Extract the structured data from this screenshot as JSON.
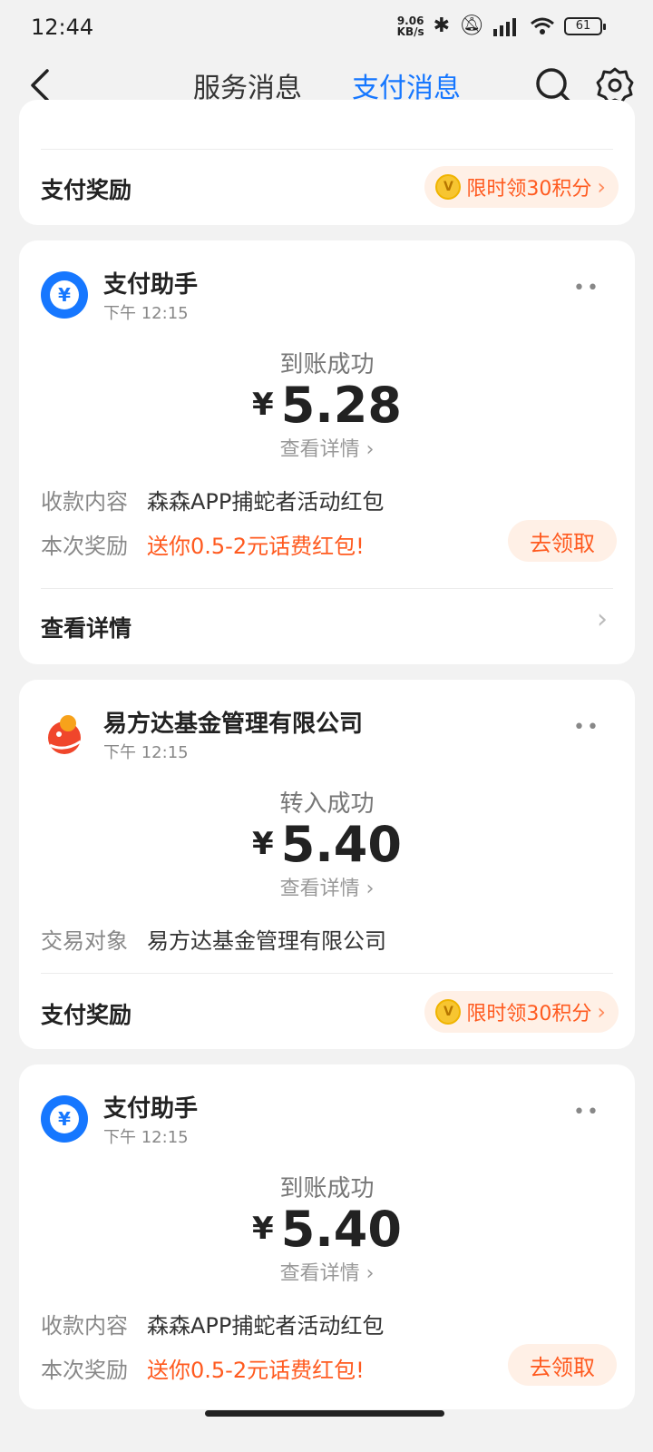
{
  "status_bar": {
    "time": "12:44",
    "net_speed_top": "9.06",
    "net_speed_bottom": "KB/s",
    "battery": "61"
  },
  "nav": {
    "tabs": [
      {
        "label": "服务消息"
      },
      {
        "label": "支付消息"
      }
    ],
    "active_tab": "支付消息"
  },
  "cards": [
    {
      "reward_label": "支付奖励",
      "points_label": "限时领30积分"
    },
    {
      "sender": "支付助手",
      "time": "下午 12:15",
      "status": "到账成功",
      "currency": "¥",
      "amount": "5.28",
      "detail_link": "查看详情",
      "rows": [
        {
          "label": "收款内容",
          "value": "森森APP捕蛇者活动红包"
        },
        {
          "label": "本次奖励",
          "value": "送你0.5-2元话费红包!"
        }
      ],
      "claim_label": "去领取",
      "footer": "查看详情"
    },
    {
      "sender": "易方达基金管理有限公司",
      "time": "下午 12:15",
      "status": "转入成功",
      "currency": "¥",
      "amount": "5.40",
      "detail_link": "查看详情",
      "rows": [
        {
          "label": "交易对象",
          "value": "易方达基金管理有限公司"
        }
      ],
      "reward_label": "支付奖励",
      "points_label": "限时领30积分"
    },
    {
      "sender": "支付助手",
      "time": "下午 12:15",
      "status": "到账成功",
      "currency": "¥",
      "amount": "5.40",
      "detail_link": "查看详情",
      "rows": [
        {
          "label": "收款内容",
          "value": "森森APP捕蛇者活动红包"
        },
        {
          "label": "本次奖励",
          "value": "送你0.5-2元话费红包!"
        }
      ],
      "claim_label": "去领取"
    }
  ],
  "colors": {
    "accent": "#1677ff",
    "promo": "#ff5a1f",
    "promo_bg": "#fff0e6",
    "background": "#f2f2f2"
  }
}
